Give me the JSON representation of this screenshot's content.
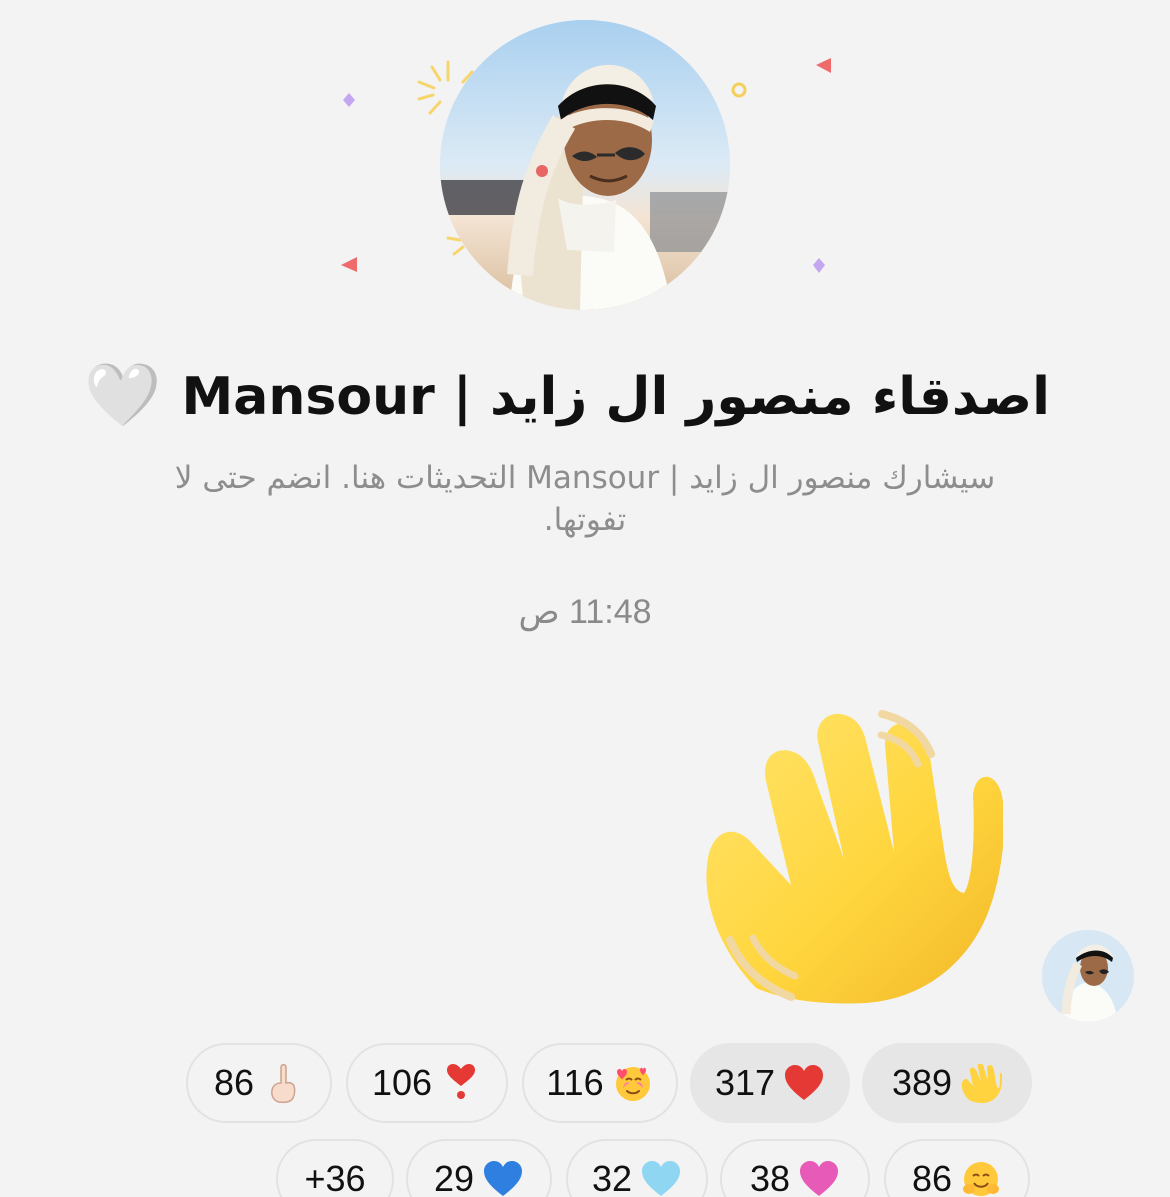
{
  "header": {
    "title": "اصدقاء منصور ال زايد | Mansour",
    "title_emoji": "🤍",
    "description": "سيشارك منصور ال زايد | Mansour التحديثات هنا. انضم حتى لا تفوتها.",
    "timestamp": "11:48 ص"
  },
  "message": {
    "emoji": "waving-hand",
    "emoji_glyph": "👋"
  },
  "reactions": {
    "row1": [
      {
        "count": "389",
        "emoji": "👋",
        "icon": "waving-hand-icon",
        "active": true
      },
      {
        "count": "317",
        "emoji": "❤️",
        "icon": "red-heart-icon",
        "active": true
      },
      {
        "count": "116",
        "emoji": "🥰",
        "icon": "smiling-face-hearts-icon",
        "active": false
      },
      {
        "count": "106",
        "emoji": "❣️",
        "icon": "heart-exclamation-icon",
        "active": false
      },
      {
        "count": "86",
        "emoji": "☝🏻",
        "icon": "index-pointing-up-icon",
        "active": false
      }
    ],
    "row2": [
      {
        "count": "86",
        "emoji": "🤗",
        "icon": "hugging-face-icon",
        "active": false
      },
      {
        "count": "38",
        "emoji": "💗",
        "icon": "pink-heart-icon",
        "active": false
      },
      {
        "count": "32",
        "emoji": "🩵",
        "icon": "light-blue-heart-icon",
        "active": false
      },
      {
        "count": "29",
        "emoji": "💙",
        "icon": "blue-heart-icon",
        "active": false
      },
      {
        "count": "+36",
        "emoji": "",
        "icon": "",
        "active": false
      }
    ]
  },
  "colors": {
    "background": "#f3f3f3",
    "title": "#111111",
    "muted": "#8d8d8d",
    "pill_border": "#e2e2e2",
    "pill_active": "#e6e6e6"
  }
}
